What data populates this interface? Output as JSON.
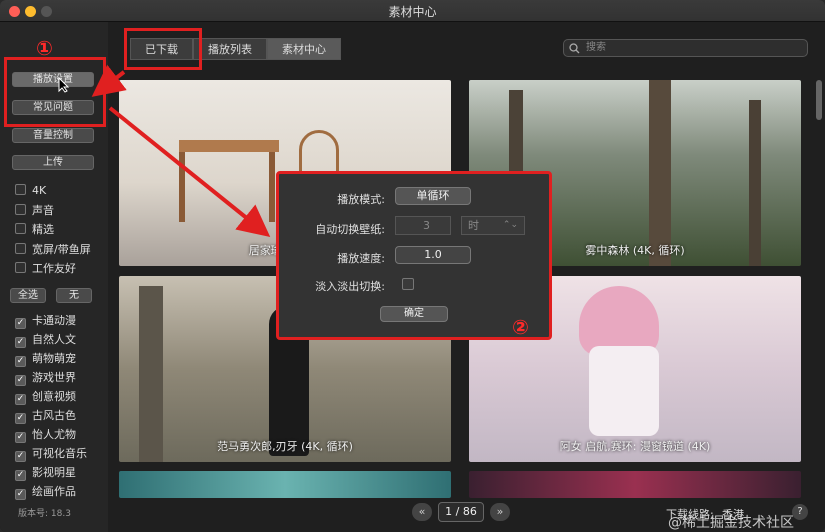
{
  "window": {
    "title": "素材中心"
  },
  "sidebar": {
    "buttons": [
      "播放设置",
      "常见问题",
      "音量控制",
      "上传"
    ],
    "filters": [
      {
        "label": "4K",
        "checked": false
      },
      {
        "label": "声音",
        "checked": false
      },
      {
        "label": "精选",
        "checked": false
      },
      {
        "label": "宽屏/带鱼屏",
        "checked": false
      },
      {
        "label": "工作友好",
        "checked": false
      }
    ],
    "select_all": "全选",
    "select_none": "无",
    "categories": [
      {
        "label": "卡通动漫",
        "checked": true
      },
      {
        "label": "自然人文",
        "checked": true
      },
      {
        "label": "萌物萌宠",
        "checked": true
      },
      {
        "label": "游戏世界",
        "checked": true
      },
      {
        "label": "创意视频",
        "checked": true
      },
      {
        "label": "古风古色",
        "checked": true
      },
      {
        "label": "怡人尤物",
        "checked": true
      },
      {
        "label": "可视化音乐",
        "checked": true
      },
      {
        "label": "影视明星",
        "checked": true
      },
      {
        "label": "绘画作品",
        "checked": true
      }
    ],
    "version": "版本号: 18.3"
  },
  "tabs": [
    "已下载",
    "播放列表",
    "素材中心"
  ],
  "search": {
    "placeholder": "搜索"
  },
  "tiles": [
    {
      "caption": "居家瑜伽, 首..."
    },
    {
      "caption": "雾中森林 (4K, 循环)"
    },
    {
      "caption": "范马勇次郎,刃牙 (4K, 循环)"
    },
    {
      "caption": "阿女 启航,赛环: 漫窗镜道 (4K)"
    }
  ],
  "dialog": {
    "play_mode_label": "播放模式:",
    "play_mode_value": "单循环",
    "auto_switch_label": "自动切换壁纸:",
    "auto_switch_value": "3",
    "auto_switch_unit": "时",
    "speed_label": "播放速度:",
    "speed_value": "1.0",
    "fade_label": "淡入淡出切换:",
    "confirm": "确定"
  },
  "pagination": {
    "page": "1 / 86",
    "prev": "«",
    "next": "»"
  },
  "footer": {
    "download_route_label": "下载线路:",
    "route_value": "香港",
    "help": "?",
    "watermark": "@稀土掘金技术社区"
  },
  "annotations": {
    "one": "①",
    "two": "②"
  },
  "colors": {
    "highlight": "#e02020"
  }
}
